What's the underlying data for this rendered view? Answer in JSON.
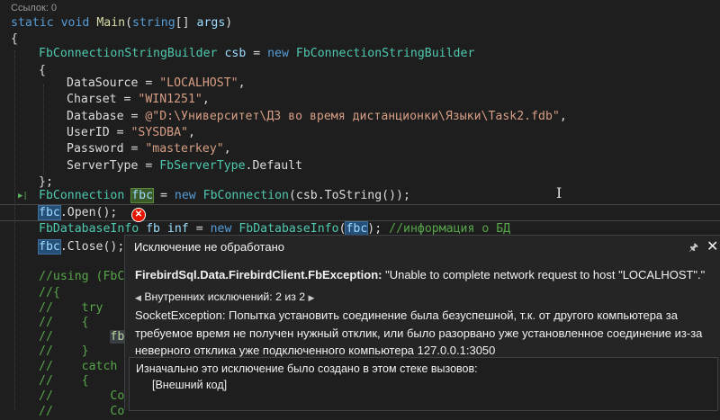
{
  "codelens": "Ссылок: 0",
  "code": {
    "l1_kw1": "static",
    "l1_kw2": "void",
    "l1_name": "Main",
    "l1_open": "(",
    "l1_kw3": "string",
    "l1_br": "[] ",
    "l1_prm": "args",
    "l1_close": ")",
    "brace_open": "{",
    "csb_type": "FbConnectionStringBuilder",
    "csb_var": "csb",
    "eq": " = ",
    "kw_new": "new",
    "csb_ctor": "FbConnectionStringBuilder",
    "inner_open": "{",
    "ds_prop": "DataSource",
    "ds_val": "\"LOCALHOST\"",
    "cs_prop": "Charset",
    "cs_val": "\"WIN1251\"",
    "db_prop": "Database",
    "db_val": "@\"D:\\Университет\\ДЗ во время дистанционки\\Языки\\Task2.fdb\"",
    "uid_prop": "UserID",
    "uid_val": "\"SYSDBA\"",
    "pwd_prop": "Password",
    "pwd_val": "\"masterkey\"",
    "st_prop": "ServerType",
    "st_type": "FbServerType",
    "st_rest": ".Default",
    "inner_close": "};",
    "conn_type": "FbConnection",
    "conn_var": "fbc",
    "conn_ctor": "FbConnection",
    "conn_args": "(csb.ToString());",
    "open_var": "fbc",
    "open_call": ".Open();",
    "info_type": "FbDatabaseInfo",
    "info_var": "fb inf",
    "info_ctor": "FbDatabaseInfo",
    "info_arg": "fbc",
    "info_end": "); ",
    "info_cmt": "//информация о БД",
    "close_var": "fbc",
    "close_call": ".Close();",
    "c1": "//using (FbC",
    "c2": "//{",
    "c3": "//    try",
    "c4": "//    {",
    "c5": "//        ",
    "c5_tok": "fb",
    "c6": "//    }",
    "c7": "//    catch",
    "c8": "//    {",
    "c9": "//        Co",
    "c10": "//        Co"
  },
  "popup": {
    "title": "Исключение не обработано",
    "pin_icon": "pin-icon",
    "close_icon": "close-icon",
    "exception_type": "FirebirdSql.Data.FirebirdClient.FbException:",
    "exception_message": " \"Unable to complete network request to host \"LOCALHOST\".\"",
    "inner_label": "Внутренних исключений: 2 из 2",
    "socket_message": "SocketException: Попытка установить соединение была безуспешной, т.к. от другого компьютера за требуемое время не получен нужный отклик, или было разорвано уже установленное соединение из-за неверного отклика уже подключенного компьютера 127.0.0.1:3050",
    "stack_header": "Изначально это исключение было создано в этом стеке вызовов:",
    "stack_item": "[Внешний код]"
  }
}
